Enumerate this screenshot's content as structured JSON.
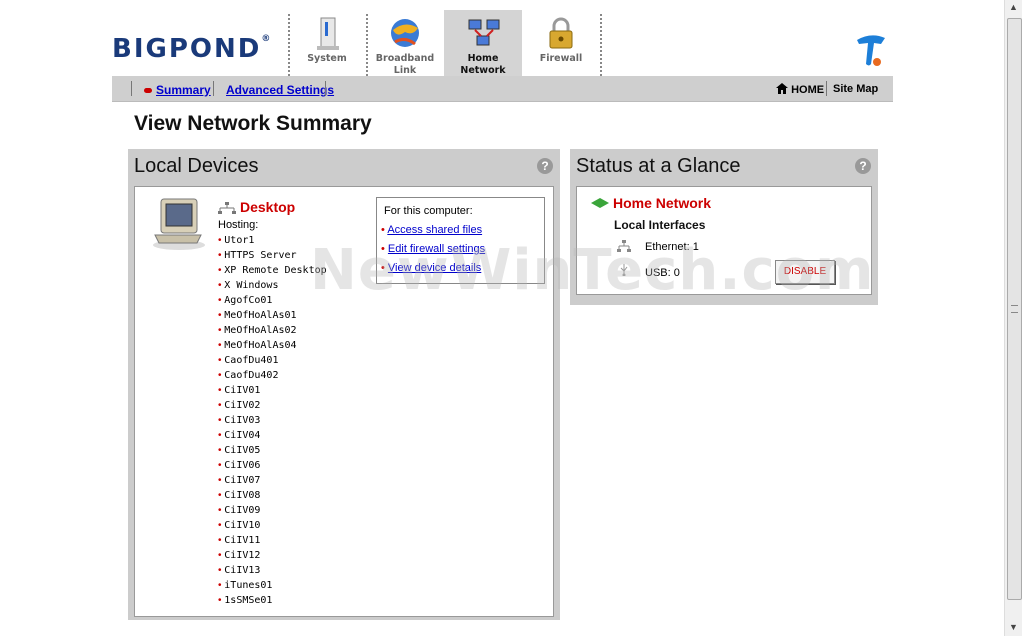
{
  "header": {
    "logo_text": "BIGPOND",
    "logo_reg": "®",
    "tabs": [
      {
        "label1": "System",
        "label2": ""
      },
      {
        "label1": "Broadband",
        "label2": "Link"
      },
      {
        "label1": "Home",
        "label2": "Network"
      },
      {
        "label1": "Firewall",
        "label2": ""
      }
    ],
    "active_tab": "Home Network"
  },
  "menubar": {
    "summary": "Summary",
    "advanced": "Advanced Settings",
    "home": "HOME",
    "sitemap": "Site Map"
  },
  "page_title": "View Network Summary",
  "local_devices": {
    "title": "Local Devices",
    "help": "?",
    "device_name": "Desktop",
    "hosting_label": "Hosting:",
    "hosting": [
      "Utor1",
      "HTTPS Server",
      "XP Remote Desktop",
      "X Windows",
      "AgofCo01",
      "MeOfHoAlAs01",
      "MeOfHoAlAs02",
      "MeOfHoAlAs04",
      "CaofDu401",
      "CaofDu402",
      "CiIV01",
      "CiIV02",
      "CiIV03",
      "CiIV04",
      "CiIV05",
      "CiIV06",
      "CiIV07",
      "CiIV08",
      "CiIV09",
      "CiIV10",
      "CiIV11",
      "CiIV12",
      "CiIV13",
      "iTunes01",
      "1sSMSe01"
    ],
    "computer_box": {
      "header": "For this computer:",
      "links": [
        "Access shared files",
        "Edit firewall settings",
        "View device details"
      ]
    }
  },
  "status": {
    "title": "Status at a Glance",
    "help": "?",
    "home_network": "Home Network",
    "local_interfaces": "Local Interfaces",
    "ethernet": "Ethernet: 1",
    "usb": "USB: 0",
    "disable": "DISABLE"
  },
  "watermark": "NewWinTech.com",
  "colors": {
    "accent_red": "#cc0000",
    "panel_gray": "#cccccc",
    "link_blue": "#0000cc",
    "logo_blue": "#1a3a7a"
  }
}
